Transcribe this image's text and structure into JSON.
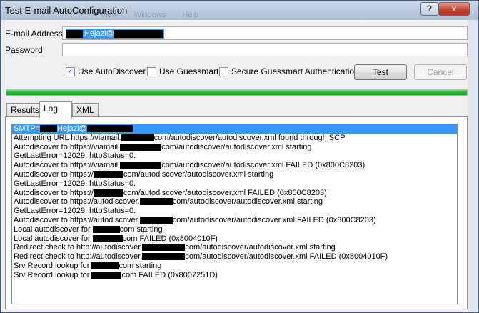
{
  "window": {
    "title": "Test E-mail AutoConfiguration",
    "background_window_text": "View Windows Help",
    "help_button": "?",
    "close_button": "x"
  },
  "form": {
    "email_label": "E-mail Address",
    "email_value": "Hejazi@",
    "password_label": "Password",
    "password_value": ""
  },
  "options": [
    {
      "label": "Use AutoDiscover",
      "checked": true
    },
    {
      "label": "Use Guessmart",
      "checked": false
    },
    {
      "label": "Secure Guessmart Authentication",
      "checked": false
    }
  ],
  "buttons": {
    "test": "Test",
    "cancel": "Cancel"
  },
  "progress": {
    "percent": 100,
    "color": "#1fbf2f"
  },
  "tabs": [
    {
      "label": "Results",
      "active": false
    },
    {
      "label": "Log",
      "active": true
    },
    {
      "label": "XML",
      "active": false
    }
  ],
  "log_lines": [
    {
      "parts": [
        "SMTP=",
        "#",
        "Hejazi@",
        "#"
      ],
      "selected": true
    },
    {
      "parts": [
        "Attempting URL https://viamail.",
        "#",
        "com/autodiscover/autodiscover.xml found through SCP"
      ]
    },
    {
      "parts": [
        "Autodiscover to https://viamail.",
        "#",
        "com/autodiscover/autodiscover.xml starting"
      ]
    },
    {
      "parts": [
        "GetLastError=12029; httpStatus=0."
      ]
    },
    {
      "parts": [
        "Autodiscover to https://viamail.",
        "#",
        "com/autodiscover/autodiscover.xml FAILED (0x800C8203)"
      ]
    },
    {
      "parts": [
        "Autodiscover to https://",
        "#",
        "com/autodiscover/autodiscover.xml starting"
      ]
    },
    {
      "parts": [
        "GetLastError=12029; httpStatus=0."
      ]
    },
    {
      "parts": [
        "Autodiscover to https://",
        "#",
        "com/autodiscover/autodiscover.xml FAILED (0x800C8203)"
      ]
    },
    {
      "parts": [
        "Autodiscover to https://autodiscover.",
        "#",
        "com/autodiscover/autodiscover.xml starting"
      ]
    },
    {
      "parts": [
        "GetLastError=12029; httpStatus=0."
      ]
    },
    {
      "parts": [
        "Autodiscover to https://autodiscover.",
        "#",
        "com/autodiscover/autodiscover.xml FAILED (0x800C8203)"
      ]
    },
    {
      "parts": [
        "Local autodiscover for ",
        "#",
        "com starting"
      ]
    },
    {
      "parts": [
        "Local autodiscover for ",
        "#",
        "com FAILED (0x8004010F)"
      ]
    },
    {
      "parts": [
        "Redirect check to http://autodiscover.",
        "#",
        "com/autodiscover/autodiscover.xml starting"
      ]
    },
    {
      "parts": [
        "Redirect check to http://autodiscover.",
        "#",
        "com/autodiscover/autodiscover.xml FAILED (0x8004010F)"
      ]
    },
    {
      "parts": [
        "Srv Record lookup for ",
        "#",
        "com starting"
      ]
    },
    {
      "parts": [
        "Srv Record lookup for ",
        "#",
        "com FAILED (0x8007251D)"
      ]
    }
  ]
}
